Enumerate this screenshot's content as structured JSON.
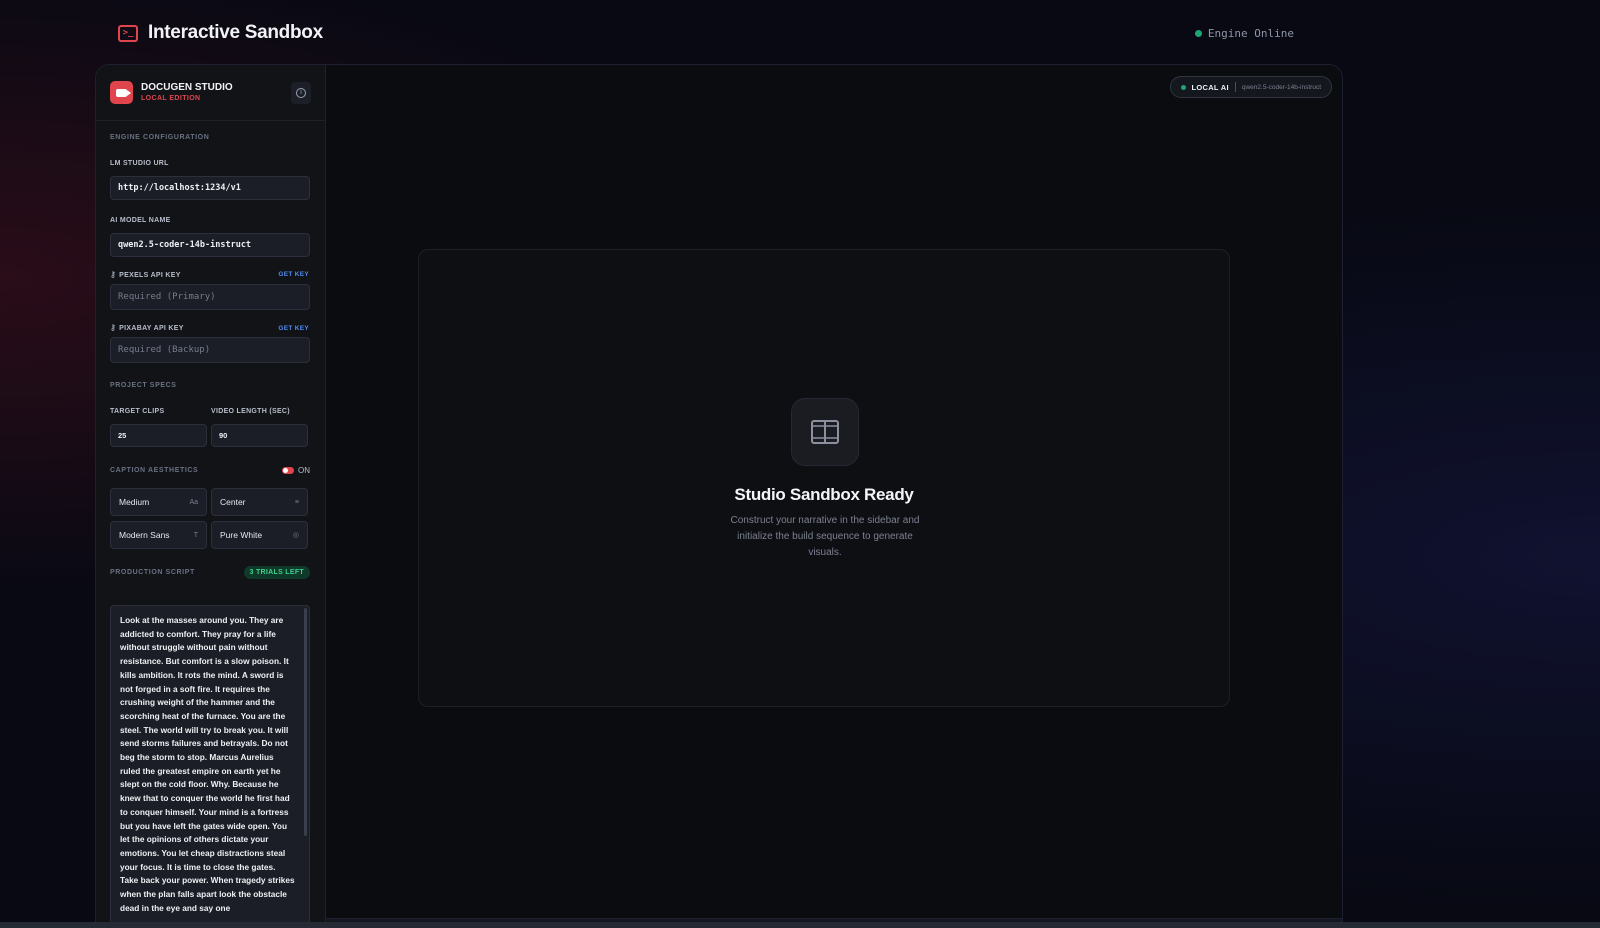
{
  "header": {
    "title": "Interactive Sandbox",
    "status": "Engine Online"
  },
  "sidebar": {
    "brand_name": "DOCUGEN STUDIO",
    "brand_sub": "LOCAL EDITION",
    "engine_config": {
      "heading": "ENGINE CONFIGURATION",
      "lm_url_label": "LM STUDIO URL",
      "lm_url_value": "http://localhost:1234/v1",
      "model_label": "AI MODEL NAME",
      "model_value": "qwen2.5-coder-14b-instruct",
      "pexels_label": "PEXELS API KEY",
      "pexels_placeholder": "Required (Primary)",
      "pixabay_label": "PIXABAY API KEY",
      "pixabay_placeholder": "Required (Backup)",
      "get_key": "GET KEY"
    },
    "project_specs": {
      "heading": "PROJECT SPECS",
      "clips_label": "TARGET CLIPS",
      "clips_value": "25",
      "length_label": "VIDEO LENGTH (SEC)",
      "length_value": "90"
    },
    "caption": {
      "heading": "CAPTION AESTHETICS",
      "toggle_label": "ON",
      "size": "Medium",
      "align": "Center",
      "font": "Modern Sans",
      "color": "Pure White"
    },
    "script": {
      "heading": "PRODUCTION SCRIPT",
      "trials": "3 TRIALS LEFT",
      "text": "Look at the masses around you. They are addicted to comfort. They pray for a life without struggle without pain without resistance. But comfort is a slow poison. It kills ambition. It rots the mind. A sword is not forged in a soft fire. It requires the crushing weight of the hammer and the scorching heat of the furnace. You are the steel. The world will try to break you. It will send storms failures and betrayals. Do not beg the storm to stop. Marcus Aurelius ruled the greatest empire on earth yet he slept on the cold floor. Why. Because he knew that to conquer the world he first had to conquer himself. Your mind is a fortress but you have left the gates wide open. You let the opinions of others dictate your emotions. You let cheap distractions steal your focus. It is time to close the gates. Take back your power. When tragedy strikes when the plan falls apart look the obstacle dead in the eye and say one"
    }
  },
  "main": {
    "badge_label": "LOCAL AI",
    "badge_model": "qwen2.5-coder-14b-instruct",
    "stage_title": "Studio Sandbox Ready",
    "stage_sub": "Construct your narrative in the sidebar and initialize the build sequence to generate visuals."
  },
  "colors": {
    "accent": "#e0454e",
    "online": "#1ea672",
    "link": "#4f8cf0",
    "trials": "#3fd08f"
  }
}
